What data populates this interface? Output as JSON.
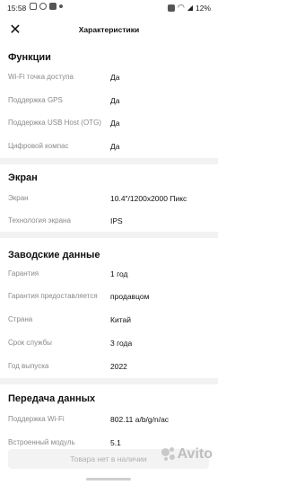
{
  "status_bar": {
    "time": "15:58",
    "battery": "12%"
  },
  "header": {
    "title": "Характеристики",
    "close_icon": "close-icon"
  },
  "sections": [
    {
      "title": "Функции",
      "rows": [
        {
          "label": "Wi-Fi точка доступа",
          "value": "Да"
        },
        {
          "label": "Поддержка GPS",
          "value": "Да"
        },
        {
          "label": "Поддержка USB Host (OTG)",
          "value": "Да"
        },
        {
          "label": "Цифровой компас",
          "value": "Да"
        }
      ]
    },
    {
      "title": "Экран",
      "rows": [
        {
          "label": "Экран",
          "value": "10.4\"/1200x2000 Пикс"
        },
        {
          "label": "Технология экрана",
          "value": "IPS"
        }
      ]
    },
    {
      "title": "Заводские данные",
      "rows": [
        {
          "label": "Гарантия",
          "value": "1 год"
        },
        {
          "label": "Гарантия предоставляется",
          "value": "продавцом"
        },
        {
          "label": "Страна",
          "value": "Китай"
        },
        {
          "label": "Срок службы",
          "value": "3 года"
        },
        {
          "label": "Год выпуска",
          "value": "2022"
        }
      ]
    },
    {
      "title": "Передача данных",
      "rows": [
        {
          "label": "Поддержка Wi-Fi",
          "value": "802.11 a/b/g/n/ac"
        },
        {
          "label": "Встроенный модуль",
          "value": "5.1"
        }
      ]
    }
  ],
  "bottom_button": {
    "label": "Товара нет в наличии"
  },
  "watermark": {
    "text": "Avito"
  }
}
